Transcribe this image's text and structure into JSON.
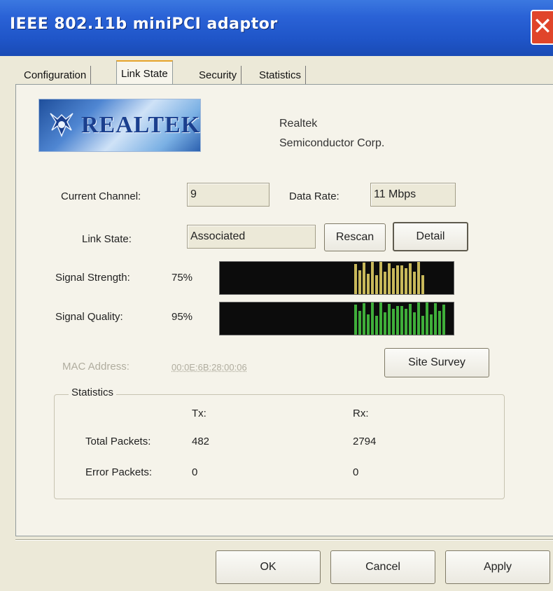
{
  "window": {
    "title": "IEEE 802.11b miniPCI adaptor",
    "close_glyph": "✕"
  },
  "tabs": [
    {
      "label": "Configuration",
      "active": false
    },
    {
      "label": "Link State",
      "active": true
    },
    {
      "label": "Security",
      "active": false
    },
    {
      "label": "Statistics",
      "active": false
    }
  ],
  "vendor": {
    "logo_text": "REALTEK",
    "line1": "Realtek",
    "line2": "Semiconductor Corp."
  },
  "link": {
    "current_channel_label": "Current Channel:",
    "current_channel_value": "9",
    "data_rate_label": "Data Rate:",
    "data_rate_value": "11 Mbps",
    "link_state_label": "Link State:",
    "link_state_value": "Associated",
    "rescan_label": "Rescan",
    "detail_label": "Detail"
  },
  "signal": {
    "strength_label": "Signal Strength:",
    "strength_value": "75%",
    "strength_level": 0.75,
    "quality_label": "Signal Quality:",
    "quality_value": "95%",
    "quality_level": 0.95,
    "meter_color_strength": "#c8b85a",
    "meter_color_quality": "#3fae3a"
  },
  "mac": {
    "label": "MAC Address:",
    "value": "00:0E:6B:28:00:06",
    "site_survey_label": "Site Survey"
  },
  "statistics": {
    "legend": "Statistics",
    "tx_header": "Tx:",
    "rx_header": "Rx:",
    "total_packets_label": "Total Packets:",
    "total_tx": "482",
    "total_rx": "2794",
    "error_packets_label": "Error Packets:",
    "error_tx": "0",
    "error_rx": "0"
  },
  "footer": {
    "ok_label": "OK",
    "cancel_label": "Cancel",
    "apply_label": "Apply"
  },
  "icons": {
    "close": "close-icon",
    "logo": "realtek-logo-icon"
  }
}
